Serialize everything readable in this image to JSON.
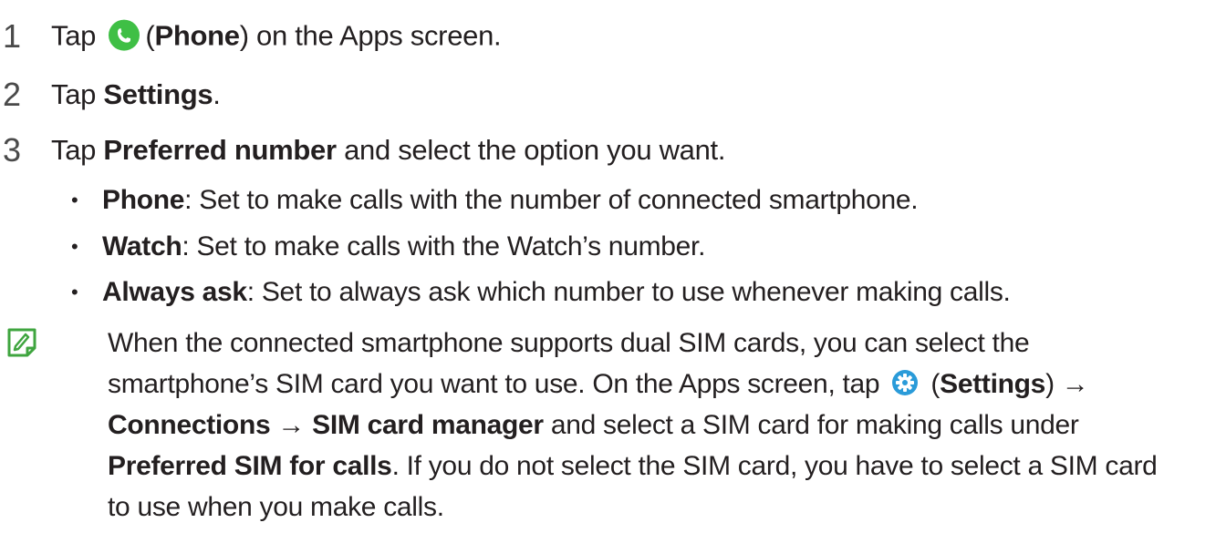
{
  "steps": [
    {
      "number": "1",
      "parts": {
        "pre": "Tap",
        "icon": "phone-icon",
        "open_paren": "(",
        "bold": "Phone",
        "post": ") on the Apps screen."
      }
    },
    {
      "number": "2",
      "parts": {
        "pre": "Tap ",
        "bold": "Settings",
        "post": "."
      }
    },
    {
      "number": "3",
      "parts": {
        "pre": "Tap ",
        "bold": "Preferred number",
        "post": " and select the option you want."
      }
    }
  ],
  "options": [
    {
      "bullet": "•",
      "label": "Phone",
      "desc": ": Set to make calls with the number of connected smartphone."
    },
    {
      "bullet": "•",
      "label": "Watch",
      "desc": ": Set to make calls with the Watch’s number."
    },
    {
      "bullet": "•",
      "label": "Always ask",
      "desc": ": Set to always ask which number to use whenever making calls."
    }
  ],
  "note": {
    "icon": "note-icon",
    "line1": "When the connected smartphone supports dual SIM cards, you can select the",
    "line2_pre": "smartphone’s SIM card you want to use. On the Apps screen, tap",
    "line2_icon": "settings-gear-icon",
    "line2_open": "(",
    "line2_bold": "Settings",
    "line2_post": ") →",
    "line3_bold1": "Connections",
    "line3_arrow": " → ",
    "line3_bold2": "SIM card manager",
    "line3_post": " and select a SIM card for making calls under",
    "line4_bold": "Preferred SIM for calls",
    "line4_post": ". If you do not select the SIM card, you have to select a SIM card",
    "line5": "to use when you make calls."
  },
  "colors": {
    "text": "#231f20",
    "phone_icon": "#3fbf45",
    "note_icon": "#3fa53f",
    "gear_icon": "#2a9bd9"
  }
}
